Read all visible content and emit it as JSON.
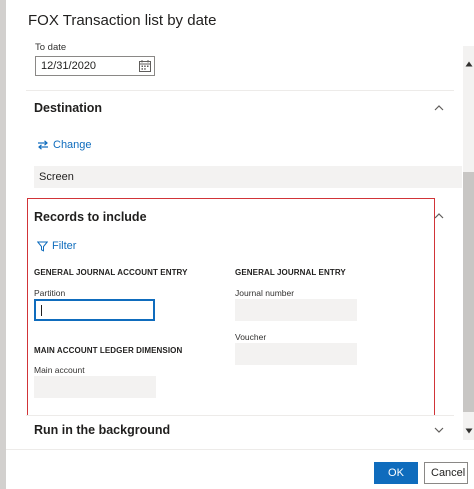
{
  "dialog": {
    "title": "FOX Transaction list by date"
  },
  "to_date": {
    "label": "To date",
    "value": "12/31/2020"
  },
  "destination": {
    "title": "Destination",
    "change_label": "Change",
    "value": "Screen"
  },
  "records": {
    "title": "Records to include",
    "filter_label": "Filter",
    "group_gjae": {
      "title": "GENERAL JOURNAL ACCOUNT ENTRY",
      "partition_label": "Partition",
      "partition_value": ""
    },
    "group_mald": {
      "title": "MAIN ACCOUNT LEDGER DIMENSION",
      "main_account_label": "Main account"
    },
    "group_gje": {
      "title": "GENERAL JOURNAL ENTRY",
      "journal_number_label": "Journal number",
      "voucher_label": "Voucher"
    }
  },
  "background": {
    "title": "Run in the background"
  },
  "buttons": {
    "ok": "OK",
    "cancel": "Cancel"
  },
  "colors": {
    "accent": "#0f6cbd",
    "highlight": "#d13438"
  }
}
